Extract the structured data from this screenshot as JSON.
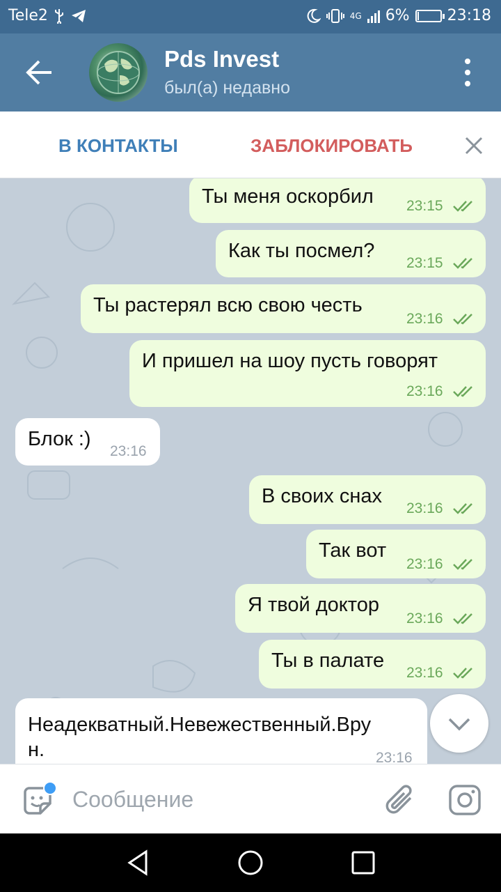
{
  "status_bar": {
    "carrier": "Tele2",
    "network": "4G",
    "battery": "6%",
    "battery_level": 0.06,
    "time": "23:18"
  },
  "header": {
    "title": "Pds Invest",
    "subtitle": "был(а) недавно"
  },
  "action_bar": {
    "add_contact": "В КОНТАКТЫ",
    "block": "ЗАБЛОКИРОВАТЬ"
  },
  "messages": [
    {
      "direction": "out",
      "text": "Ты меня оскорбил",
      "time": "23:15",
      "status": "read"
    },
    {
      "direction": "out",
      "text": "Как ты посмел?",
      "time": "23:15",
      "status": "read"
    },
    {
      "direction": "out",
      "text": "Ты растерял всю свою честь",
      "time": "23:16",
      "status": "read"
    },
    {
      "direction": "out",
      "text": "И пришел на шоу пусть говорят",
      "time": "23:16",
      "status": "read"
    },
    {
      "direction": "in",
      "text": "Блок :)",
      "time": "23:16"
    },
    {
      "direction": "out",
      "text": "В своих снах",
      "time": "23:16",
      "status": "read"
    },
    {
      "direction": "out",
      "text": "Так вот",
      "time": "23:16",
      "status": "read"
    },
    {
      "direction": "out",
      "text": "Я твой доктор",
      "time": "23:16",
      "status": "read"
    },
    {
      "direction": "out",
      "text": "Ты в палате",
      "time": "23:16",
      "status": "read"
    },
    {
      "direction": "in",
      "text_line1": "Неадекватный.Невежественный.Вру",
      "text_line2": "н.",
      "time": "23:16"
    }
  ],
  "input": {
    "placeholder": "Сообщение"
  },
  "colors": {
    "header": "#517da2",
    "status_bar": "#3e6a91",
    "chat_bg": "#c3ced9",
    "out_bubble": "#effdde",
    "in_bubble": "#ffffff",
    "accent_blue": "#3f7fb8",
    "block_red": "#d35d5d",
    "read_green": "#6aa85a"
  },
  "icons": [
    "back-arrow-icon",
    "more-vert-icon",
    "close-icon",
    "double-check-icon",
    "chevron-down-icon",
    "sticker-icon",
    "attach-icon",
    "camera-icon",
    "nav-back-icon",
    "nav-home-icon",
    "nav-recents-icon"
  ]
}
